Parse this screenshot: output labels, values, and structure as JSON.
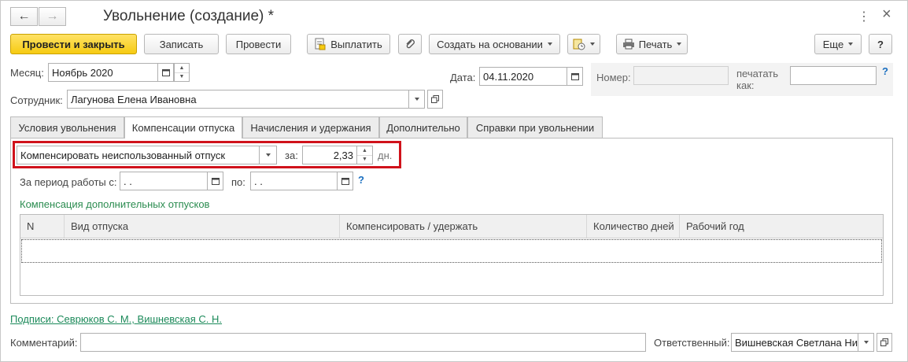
{
  "window": {
    "title": "Увольнение (создание) *",
    "more_glyph": "⋮",
    "close_glyph": "×"
  },
  "toolbar": {
    "post_close": "Провести и закрыть",
    "save": "Записать",
    "post": "Провести",
    "pay": "Выплатить",
    "create_based": "Создать на основании",
    "print": "Печать",
    "more": "Еще",
    "help": "?"
  },
  "header": {
    "month_label": "Месяц:",
    "month_value": "Ноябрь 2020",
    "date_label": "Дата:",
    "date_value": "04.11.2020",
    "number_label": "Номер:",
    "number_value": "",
    "print_as_label_line1": "печатать",
    "print_as_label_line2": "как:",
    "print_as_value": "",
    "help": "?",
    "employee_label": "Сотрудник:",
    "employee_value": "Лагунова Елена Ивановна"
  },
  "tabs": [
    {
      "label": "Условия увольнения"
    },
    {
      "label": "Компенсации отпуска"
    },
    {
      "label": "Начисления и удержания"
    },
    {
      "label": "Дополнительно"
    },
    {
      "label": "Справки при увольнении"
    }
  ],
  "compensation": {
    "mode_value": "Компенсировать неиспользованный отпуск",
    "for_label": "за:",
    "days_value": "2,33",
    "days_unit": "дн.",
    "period_from_label": "За период работы с:",
    "period_from_value": " .  .",
    "period_to_label": "по:",
    "period_to_value": " .  .",
    "help": "?",
    "extra_title": "Компенсация дополнительных отпусков",
    "columns": [
      "N",
      "Вид отпуска",
      "Компенсировать / удержать",
      "Количество дней",
      "Рабочий год"
    ]
  },
  "footer": {
    "signatures_link": "Подписи: Севрюков С. М., Вишневская С. Н.",
    "comment_label": "Комментарий:",
    "comment_value": "",
    "responsible_label": "Ответственный:",
    "responsible_value": "Вишневская Светлана Ни"
  },
  "colors": {
    "accent": "#f6cb12",
    "highlight": "#d0121b",
    "link": "#1c8a5a"
  }
}
